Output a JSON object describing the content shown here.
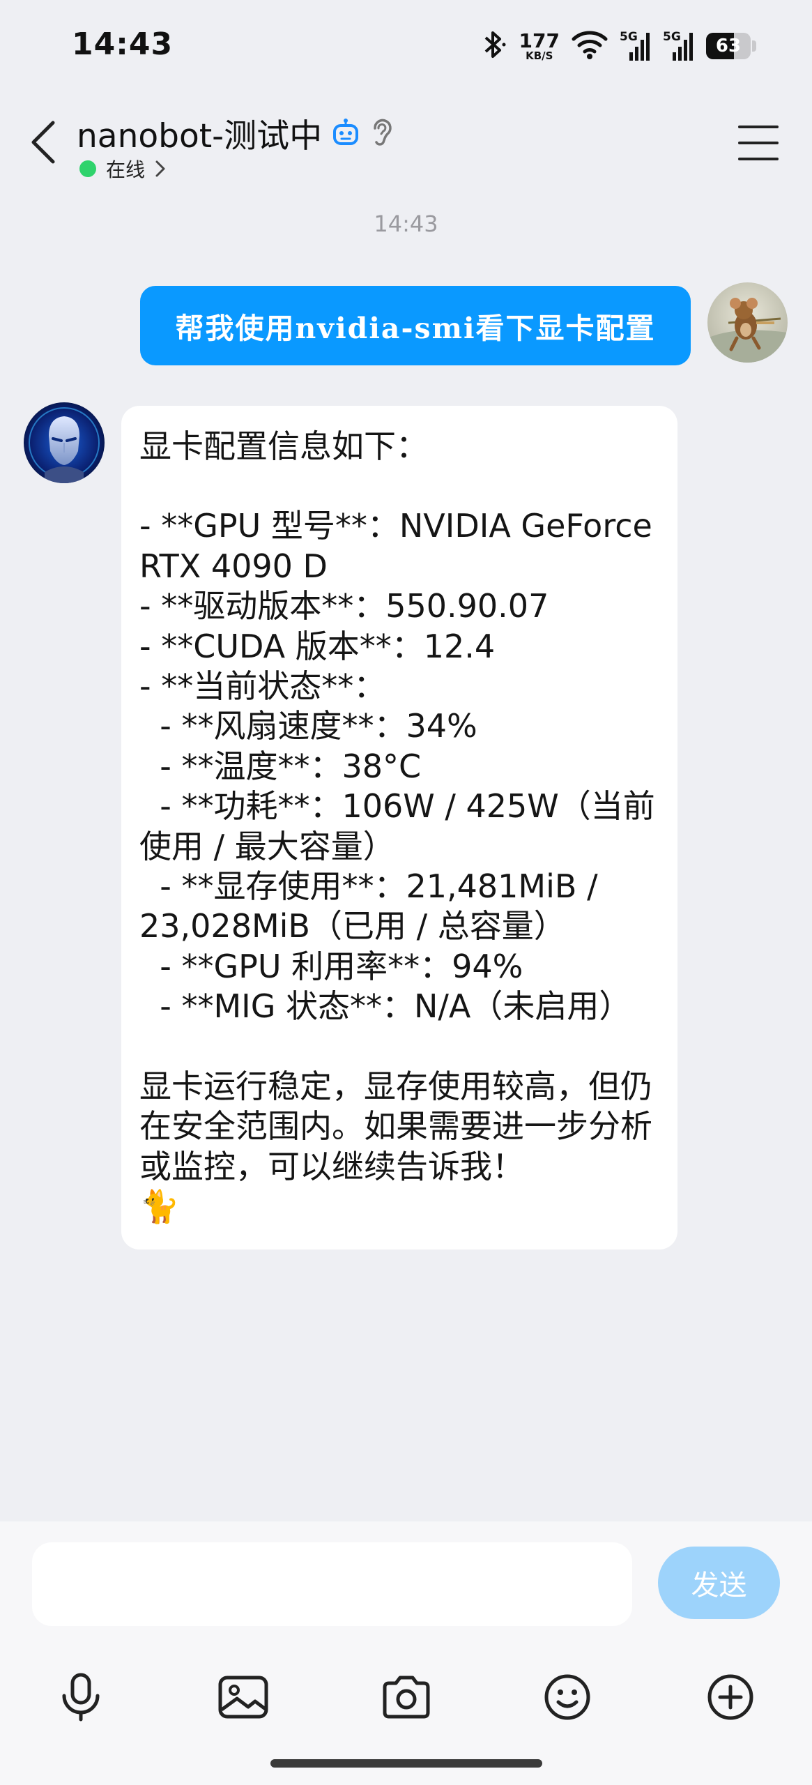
{
  "status_bar": {
    "time": "14:43",
    "net_speed_value": "177",
    "net_speed_unit": "KB/S",
    "signal_1_label": "5G",
    "signal_2_label": "5G",
    "battery_level": "63",
    "battery_fraction": 0.63
  },
  "header": {
    "title": "nanobot-测试中",
    "presence_label": "在线",
    "presence_color": "#2fd36c"
  },
  "conversation": {
    "timestamp": "14:43",
    "user_message": "帮我使用nvidia-smi看下显卡配置",
    "bot_message_lines": [
      "显卡配置信息如下：",
      "",
      "- **GPU 型号**：NVIDIA GeForce RTX 4090 D",
      "- **驱动版本**：550.90.07",
      "- **CUDA 版本**：12.4",
      "- **当前状态**：",
      "  - **风扇速度**：34%",
      "  - **温度**：38°C",
      "  - **功耗**：106W / 425W（当前使用 / 最大容量）",
      "  - **显存使用**：21,481MiB / 23,028MiB（已用 / 总容量）",
      "  - **GPU 利用率**：94%",
      "  - **MIG 状态**：N/A（未启用）",
      "",
      "显卡运行稳定，显存使用较高，但仍在安全范围内。如果需要进一步分析或监控，可以继续告诉我！",
      "🐈"
    ]
  },
  "composer": {
    "input_value": "",
    "send_label": "发送"
  },
  "toolbar": {
    "icons": [
      "microphone-icon",
      "image-icon",
      "camera-icon",
      "emoji-icon",
      "plus-circle-icon"
    ]
  },
  "colors": {
    "background": "#eeeff3",
    "user_bubble": "#0a99ff",
    "send_button": "#9dd3fb"
  }
}
